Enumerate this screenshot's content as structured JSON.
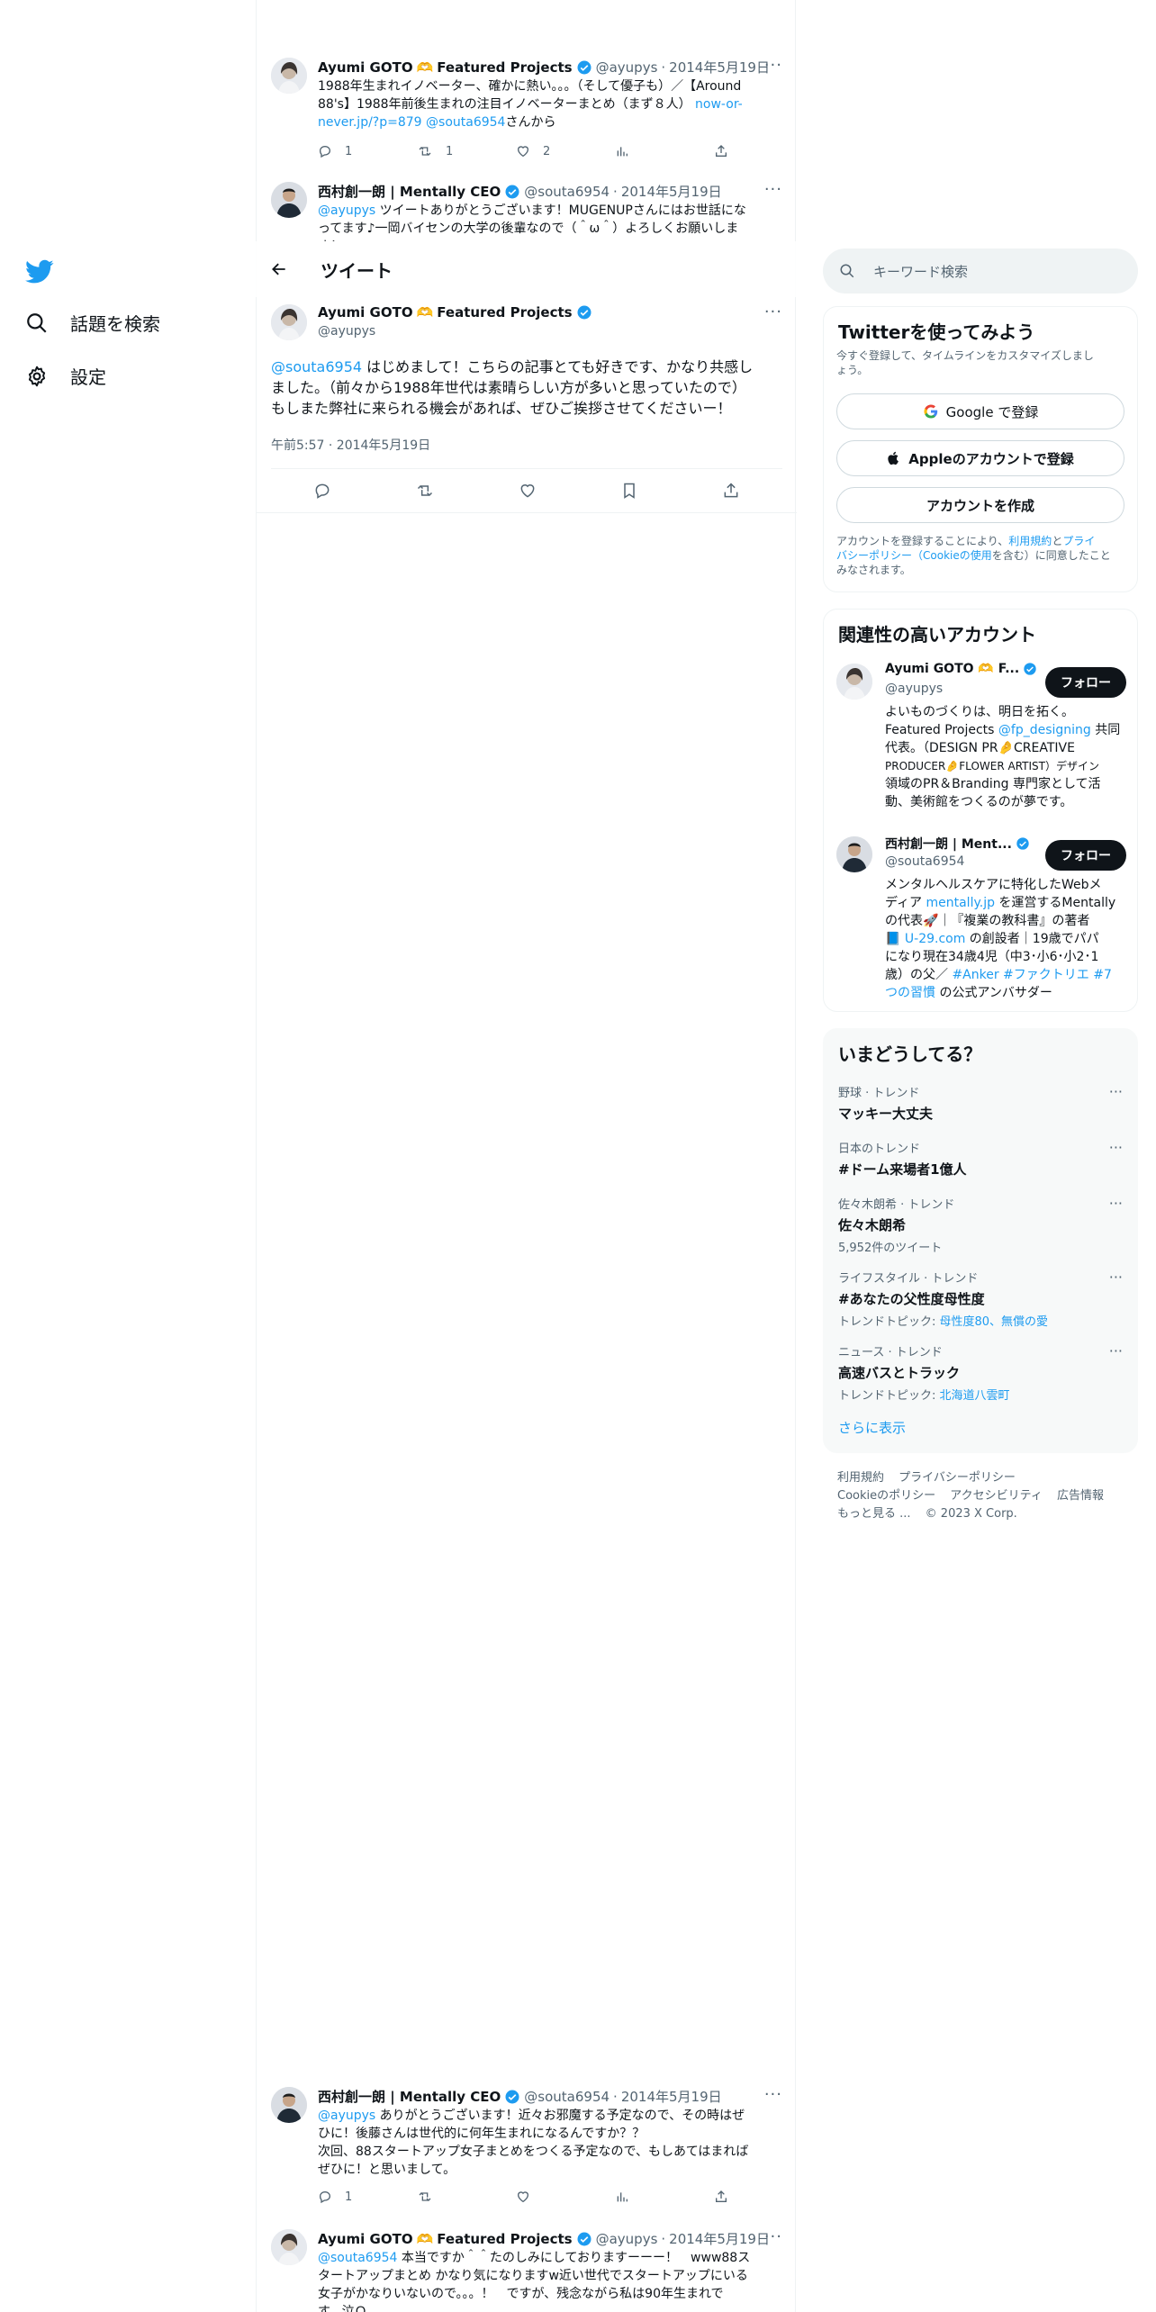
{
  "nav": {
    "search_label": "話題を検索",
    "settings_label": "設定"
  },
  "header": {
    "title": "ツイート"
  },
  "replies_above": [
    {
      "name": "Ayumi GOTO",
      "emoji": "🫶",
      "org": "Featured Projects",
      "handle": "@ayupys",
      "date": "2014年5月19日",
      "text_line1": "1988年生まれイノベーター、確かに熱い。。。（そして優子も）／【Around",
      "text_line2": "88's】1988年前後生まれの注目イノベーターまとめ（まず８人）",
      "link1": "now-or-",
      "link2": "never.jp/?p=879",
      "mention": "@souta6954",
      "text_tail": "さんから",
      "reply_count": "1",
      "retweet_count": "1",
      "like_count": "2"
    },
    {
      "name": "西村創一朗 | Mentally CEO",
      "handle": "@souta6954",
      "date": "2014年5月19日",
      "mention": "@ayupys",
      "text_line1": "ツイートありがとうございます！MUGENUPさんにはお世話にな",
      "text_line2": "ってます♪一岡バイセンの大学の後輩なので（＾ω＾）よろしくお願いしま",
      "text_line3": "す！"
    }
  ],
  "main_tweet": {
    "name": "Ayumi GOTO",
    "emoji": "🫶",
    "org": "Featured Projects",
    "handle": "@ayupys",
    "mention": "@souta6954",
    "text_line1": "はじめまして！こちらの記事とても好きです、かなり共感し",
    "text_line2": "ました。（前々から1988年世代は素晴らしい方が多いと思っていたので）",
    "text_line3": "もしまた弊社に来られる機会があれば、ぜひご挨拶させてくださいー！",
    "timestamp": "午前5:57 · 2014年5月19日"
  },
  "replies_below": [
    {
      "name": "西村創一朗 | Mentally CEO",
      "handle": "@souta6954",
      "date": "2014年5月19日",
      "mention": "@ayupys",
      "text_line1": "ありがとうございます！近々お邪魔する予定なので、その時はぜ",
      "text_line2": "ひに！後藤さんは世代的に何年生まれになるんですか？？",
      "text_line3": "次回、88スタートアップ女子まとめをつくる予定なので、もしあてはまれば",
      "text_line4": "ぜひに！と思いまして。",
      "reply_count": "1"
    },
    {
      "name": "Ayumi GOTO",
      "emoji": "🫶",
      "org": "Featured Projects",
      "handle": "@ayupys",
      "date": "2014年5月19日",
      "mention": "@souta6954",
      "text_line1": "本当ですか＾＾たのしみにしておりますーーー！　www88ス",
      "text_line2": "タートアップまとめ かなり気になりますw近い世代でスタートアップにいる",
      "text_line3": "女子がかなりいないので。。。！　ですが、残念ながら私は90年生まれで",
      "text_line4": "す。泣Ｑ"
    }
  ],
  "search": {
    "placeholder": "キーワード検索"
  },
  "signup": {
    "title": "Twitterを使ってみよう",
    "desc_line1": "今すぐ登録して、タイムラインをカスタマイズしまし",
    "desc_line2": "ょう。",
    "google_label": "Google で登録",
    "apple_label": "Appleのアカウントで登録",
    "create_label": "アカウントを作成",
    "legal_pre": "アカウントを登録することにより、",
    "legal_terms": "利用規約",
    "legal_and": "と",
    "legal_privacy_1": "プライ",
    "legal_privacy_2": "バシーポリシー",
    "legal_cookie": "（Cookieの使用",
    "legal_post_1": "を含む）に同意したこと",
    "legal_post_2": "みなされます。"
  },
  "related": {
    "title": "関連性の高いアカウント",
    "follow_label": "フォロー",
    "accounts": [
      {
        "name": "Ayumi GOTO 🫶 F...",
        "handle": "@ayupys",
        "bio_line1": "よいものづくりは、明日を拓く。",
        "bio_line2_a": "Featured Projects ",
        "bio_line2_link": "@fp_designing",
        "bio_line2_b": " 共同",
        "bio_line3": "代表。（DESIGN PR🤌CREATIVE",
        "bio_line4": "PRODUCER🤌FLOWER ARTIST）デザイン",
        "bio_line5": "領域のPR＆Branding 専門家として活",
        "bio_line6": "動、美術館をつくるのが夢です。"
      },
      {
        "name": "西村創一朗 | Ment...",
        "handle": "@souta6954",
        "bio_line1": "メンタルヘルスケアに特化したWebメ",
        "bio_line2_a": "ディア ",
        "bio_line2_link": "mentally.jp",
        "bio_line2_b": " を運営するMentally",
        "bio_line3": "の代表🚀｜『複業の教科書』の著者",
        "bio_line4_a": "📘 ",
        "bio_line4_link": "U-29.com",
        "bio_line4_b": " の創設者｜19歳でパパ",
        "bio_line5": "になり現在34歳4児（中3･小6･小2･1",
        "bio_line6": "歳）の父／",
        "bio_line6_link": " #Anker #ファクトリエ #7",
        "bio_line7_link": "つの習慣",
        "bio_line7_b": " の公式アンバサダー"
      }
    ]
  },
  "trends": {
    "title": "いまどうしてる？",
    "items": [
      {
        "context": "野球 · トレンド",
        "name": "マッキー大丈夫"
      },
      {
        "context": "日本のトレンド",
        "name": "#ドーム来場者1億人"
      },
      {
        "context": "佐々木朗希 · トレンド",
        "name": "佐々木朗希",
        "sub": "5,952件のツイート"
      },
      {
        "context": "ライフスタイル · トレンド",
        "name": "#あなたの父性度母性度",
        "sub_pre": "トレンドトピック: ",
        "sub_link": "母性度80、無償の愛"
      },
      {
        "context": "ニュース · トレンド",
        "name": "高速バスとトラック",
        "sub_pre": "トレンドトピック: ",
        "sub_link": "北海道八雲町"
      }
    ],
    "show_more": "さらに表示"
  },
  "footer": {
    "terms": "利用規約",
    "privacy": "プライバシーポリシー",
    "cookie": "Cookieのポリシー",
    "accessibility": "アクセシビリティ",
    "ads": "広告情報",
    "more": "もっと見る ...",
    "copyright": "© 2023 X Corp."
  },
  "colors": {
    "accent": "#1d9bf0",
    "text": "#0f1419",
    "muted": "#536471"
  }
}
